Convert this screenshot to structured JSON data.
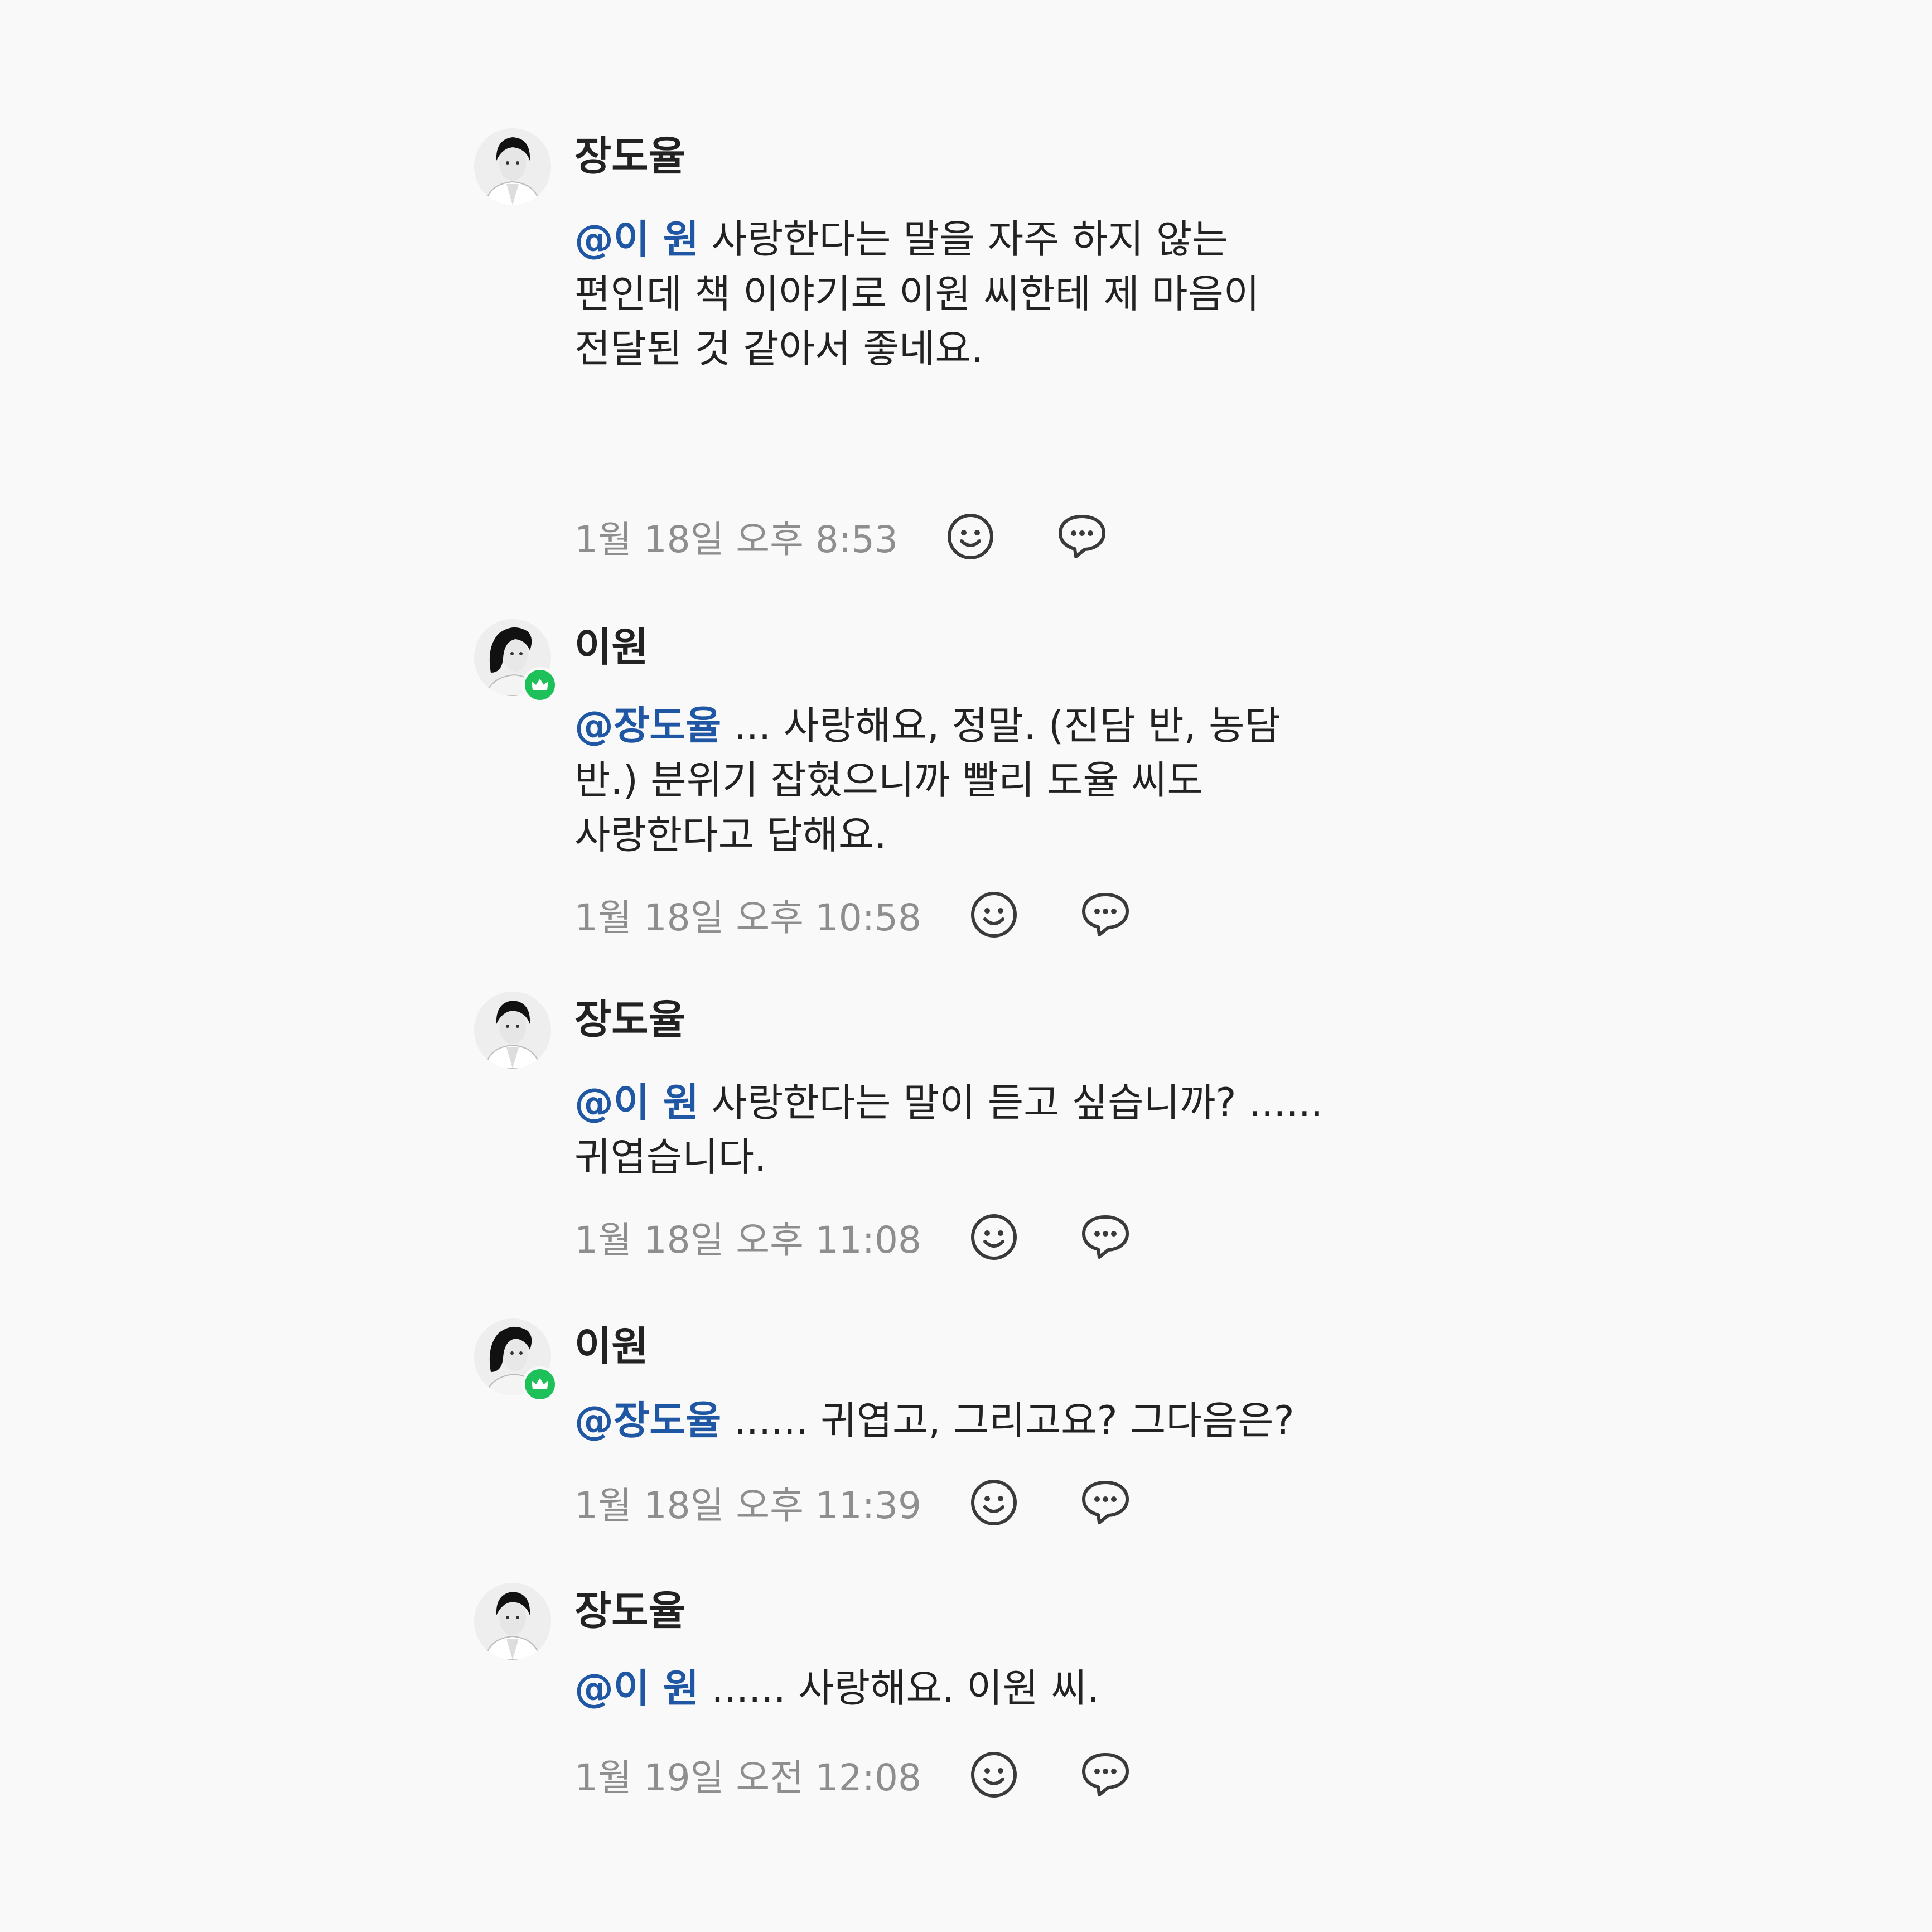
{
  "comments": [
    {
      "author": "장도율",
      "mention": "@이 원",
      "text": " 사랑한다는 말을 자주 하지 않는 편인데 책 이야기로 이원 씨한테 제 마음이 전달된 것 같아서 좋네요.",
      "time": "1월 18일 오후 8:53",
      "crown": false,
      "avatar_icon": "avatar-photo-man"
    },
    {
      "author": "이원",
      "mention": "@장도율",
      "text": " ... 사랑해요, 정말. (진담 반, 농담 반.) 분위기 잡혔으니까 빨리 도율 씨도 사랑한다고 답해요.",
      "time": "1월 18일 오후 10:58",
      "crown": true,
      "avatar_icon": "avatar-photo-woman"
    },
    {
      "author": "장도율",
      "mention": "@이 원",
      "text": " 사랑한다는 말이 듣고 싶습니까? ...... 귀엽습니다.",
      "time": "1월 18일 오후 11:08",
      "crown": false,
      "avatar_icon": "avatar-photo-man"
    },
    {
      "author": "이원",
      "mention": "@장도율",
      "text": " ...... 귀엽고, 그리고요? 그다음은?",
      "time": "1월 18일 오후 11:39",
      "crown": true,
      "avatar_icon": "avatar-photo-woman"
    },
    {
      "author": "장도율",
      "mention": "@이 원",
      "text": " ...... 사랑해요. 이원 씨.",
      "time": "1월 19일 오전 12:08",
      "crown": false,
      "avatar_icon": "avatar-photo-man"
    }
  ],
  "icons": {
    "reaction": "smile-icon",
    "reply": "speech-bubble-icon",
    "badge": "crown-icon"
  },
  "colors": {
    "background": "#f9f9f9",
    "mention": "#1f57a4",
    "text": "#222222",
    "timestamp": "#8e8e8e",
    "badge": "#1ec05a"
  }
}
